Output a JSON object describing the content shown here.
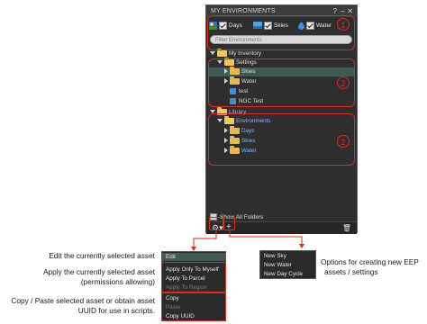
{
  "window": {
    "title": "MY ENVIRONMENTS",
    "help_label": "?",
    "minimize_label": "–",
    "close_label": "✕"
  },
  "filters": [
    {
      "label": "Days",
      "checked": true
    },
    {
      "label": "Skies",
      "checked": true
    },
    {
      "label": "Water",
      "checked": true
    }
  ],
  "search": {
    "placeholder": "Filter Environments"
  },
  "tree": {
    "my_inventory": "My Inventory",
    "settings": "Settings",
    "skies": "Skies",
    "water": "Water",
    "test": "test",
    "ngc_test": "NGC Test",
    "library": "Library",
    "environments": "Environments",
    "lib_days": "Days",
    "lib_skies": "Skies",
    "lib_water": "Water"
  },
  "show_all_folders": "Show All Folders",
  "badges": [
    "1",
    "2",
    "2"
  ],
  "bottom": {
    "gear_icon": "gear-icon",
    "plus_label": "+",
    "trash_icon": "trash-icon"
  },
  "gear_menu": {
    "edit": "Edit",
    "apply_myself": "Apply Only To Myself",
    "apply_parcel": "Apply To Parcel",
    "apply_region": "Apply To Region",
    "copy": "Copy",
    "paste": "Paste",
    "copy_uuid": "Copy UUID"
  },
  "new_menu": {
    "new_sky": "New Sky",
    "new_water": "New Water",
    "new_day_cycle": "New Day Cycle"
  },
  "captions": {
    "edit": "Edit the currently selected asset",
    "apply_1": "Apply the currently selected asset",
    "apply_2": "(permissions allowing)",
    "copy_1": "Copy / Paste selected asset or obtain asset",
    "copy_2": "UUID for use in scripts.",
    "new_1": "Options for creating new EEP",
    "new_2": "assets / settings"
  },
  "colors": {
    "annotation_red": "#e0281e",
    "selection": "#3f5a55",
    "panel_bg": "#2e2e2e"
  }
}
